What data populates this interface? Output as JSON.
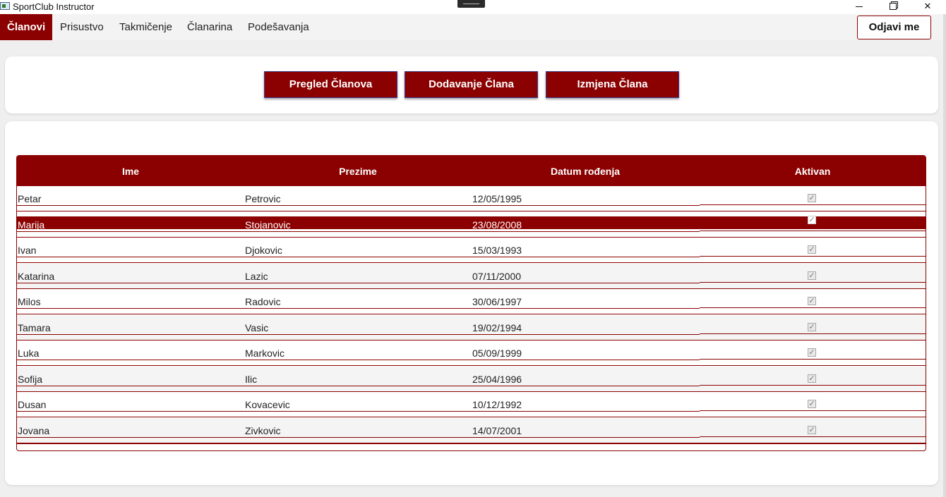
{
  "window": {
    "title": "SportClub Instructor",
    "minimize_glyph": "—",
    "close_glyph": "✕"
  },
  "menu": {
    "items": [
      "Članovi",
      "Prisustvo",
      "Takmičenje",
      "Članarina",
      "Podešavanja"
    ],
    "active_index": 0,
    "logout_label": "Odjavi me"
  },
  "subnav": {
    "buttons": [
      "Pregled Članova",
      "Dodavanje Člana",
      "Izmjena Člana"
    ]
  },
  "table": {
    "headers": [
      "Ime",
      "Prezime",
      "Datum rođenja",
      "Aktivan"
    ],
    "selected_row_index": 1,
    "rows": [
      {
        "ime": "Petar",
        "prezime": "Petrovic",
        "datum": "12/05/1995",
        "aktivan": true
      },
      {
        "ime": "Marija",
        "prezime": "Stojanovic",
        "datum": "23/08/2008",
        "aktivan": true
      },
      {
        "ime": "Ivan",
        "prezime": "Djokovic",
        "datum": "15/03/1993",
        "aktivan": true
      },
      {
        "ime": "Katarina",
        "prezime": "Lazic",
        "datum": "07/11/2000",
        "aktivan": true
      },
      {
        "ime": "Milos",
        "prezime": "Radovic",
        "datum": "30/06/1997",
        "aktivan": true
      },
      {
        "ime": "Tamara",
        "prezime": "Vasic",
        "datum": "19/02/1994",
        "aktivan": true
      },
      {
        "ime": "Luka",
        "prezime": "Markovic",
        "datum": "05/09/1999",
        "aktivan": true
      },
      {
        "ime": "Sofija",
        "prezime": "Ilic",
        "datum": "25/04/1996",
        "aktivan": true
      },
      {
        "ime": "Dusan",
        "prezime": "Kovacevic",
        "datum": "10/12/1992",
        "aktivan": true
      },
      {
        "ime": "Jovana",
        "prezime": "Zivkovic",
        "datum": "14/07/2001",
        "aktivan": true
      }
    ],
    "check_glyph": "✓"
  },
  "colors": {
    "accent": "#8b0000",
    "background": "#efefef",
    "card": "#ffffff"
  }
}
